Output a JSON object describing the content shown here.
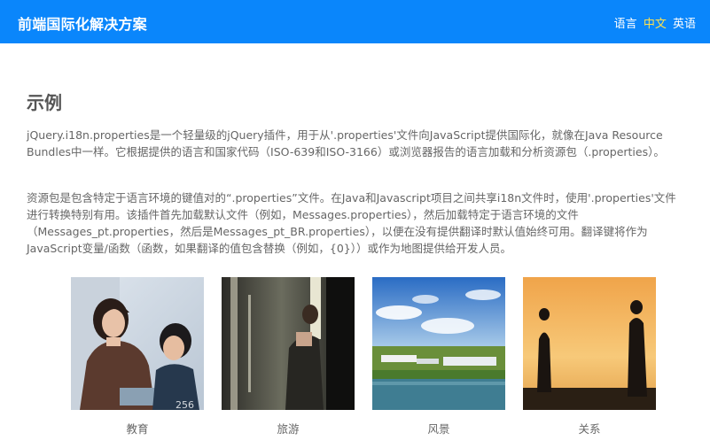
{
  "header": {
    "brand": "前端国际化解决方案",
    "lang_label": "语言",
    "lang_options": [
      "中文",
      "英语"
    ]
  },
  "main": {
    "title": "示例",
    "paragraphs": [
      "jQuery.i18n.properties是一个轻量级的jQuery插件，用于从'.properties'文件向JavaScript提供国际化，就像在Java Resource Bundles中一样。它根据提供的语言和国家代码（ISO-639和ISO-3166）或浏览器报告的语言加载和分析资源包（.properties）。",
      "资源包是包含特定于语言环境的键值对的“.properties”文件。在Java和Javascript项目之间共享i18n文件时，使用'.properties'文件进行转换特别有用。该插件首先加载默认文件（例如，Messages.properties），然后加载特定于语言环境的文件（Messages_pt.properties，然后是Messages_pt_BR.properties），以便在没有提供翻译时默认值始终可用。翻译键将作为JavaScript变量/函数（函数，如果翻译的值包含替换（例如，{0}））或作为地图提供给开发人员。"
    ],
    "gallery": [
      {
        "caption": "教育"
      },
      {
        "caption": "旅游"
      },
      {
        "caption": "风景"
      },
      {
        "caption": "关系"
      }
    ]
  },
  "colors": {
    "header": "#0a86fb",
    "active_lang": "#ffe14d"
  }
}
